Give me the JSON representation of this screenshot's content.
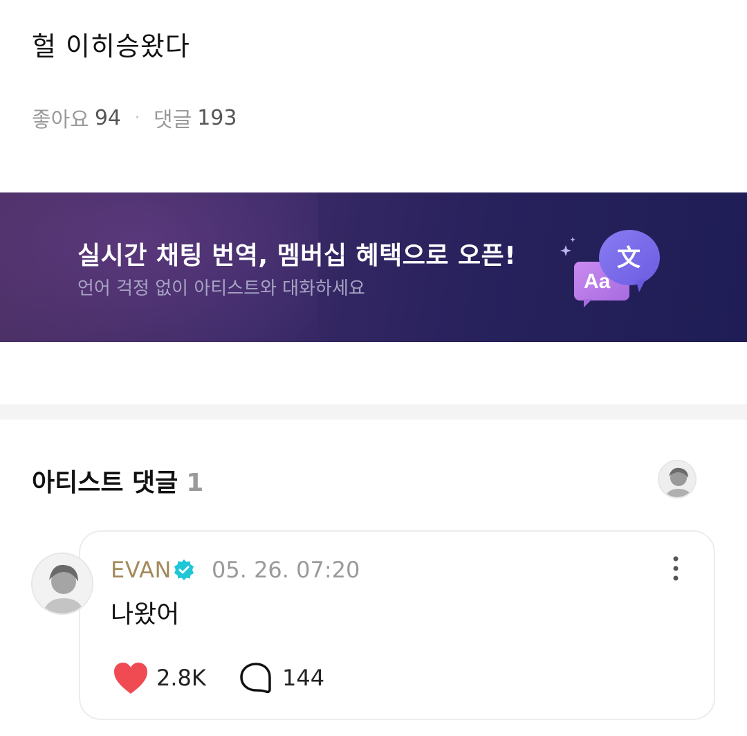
{
  "post": {
    "body": "헐 이히승왔다",
    "likes_label": "좋아요",
    "likes_count": "94",
    "separator": "·",
    "comments_label": "댓글",
    "comments_count": "193"
  },
  "banner": {
    "title": "실시간 채팅 번역, 멤버십 혜택으로 오픈!",
    "subtitle": "언어 걱정 없이 아티스트와 대화하세요",
    "icon_text_a": "Aa",
    "icon_text_b": "文",
    "icon": "translate-bubbles-icon"
  },
  "artist_comments": {
    "title": "아티스트 댓글",
    "count": "1"
  },
  "comment": {
    "author": "EVAN",
    "verified_icon": "verified-badge-icon",
    "timestamp": "05. 26. 07:20",
    "text": "나왔어",
    "likes": "2.8K",
    "replies": "144",
    "like_icon": "heart-icon",
    "reply_icon": "speech-bubble-icon",
    "more_icon": "more-vertical-icon"
  },
  "colors": {
    "author": "#a38a5a",
    "verified": "#1ec6d6",
    "heart": "#f04b52",
    "banner_start": "#4a2f63",
    "banner_end": "#1f1d55"
  }
}
